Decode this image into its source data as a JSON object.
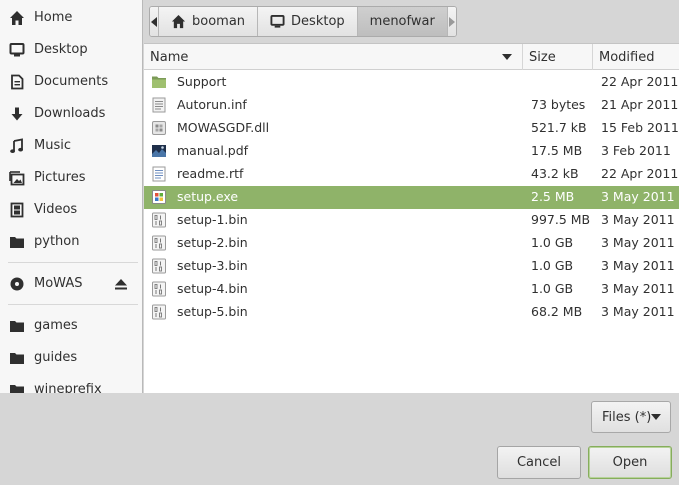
{
  "sidebar": {
    "items": [
      {
        "label": "Home",
        "icon": "home-icon"
      },
      {
        "label": "Desktop",
        "icon": "desktop-icon"
      },
      {
        "label": "Documents",
        "icon": "documents-icon"
      },
      {
        "label": "Downloads",
        "icon": "download-icon"
      },
      {
        "label": "Music",
        "icon": "music-icon"
      },
      {
        "label": "Pictures",
        "icon": "pictures-icon"
      },
      {
        "label": "Videos",
        "icon": "videos-icon"
      },
      {
        "label": "python",
        "icon": "folder-icon"
      }
    ],
    "device": {
      "label": "MoWAS",
      "icon": "disc-icon"
    },
    "bookmarks": [
      {
        "label": "games",
        "icon": "folder-icon"
      },
      {
        "label": "guides",
        "icon": "folder-icon"
      },
      {
        "label": "wineprefix",
        "icon": "folder-icon"
      }
    ]
  },
  "pathbar": {
    "crumbs": [
      "booman",
      "Desktop",
      "menofwar"
    ]
  },
  "list": {
    "columns": {
      "name": "Name",
      "size": "Size",
      "modified": "Modified"
    },
    "files": [
      {
        "name": "Support",
        "size": "",
        "modified": "22 Apr 2011",
        "icon": "folder-icon"
      },
      {
        "name": "Autorun.inf",
        "size": "73 bytes",
        "modified": "21 Apr 2011",
        "icon": "text-file-icon"
      },
      {
        "name": "MOWASGDF.dll",
        "size": "521.7 kB",
        "modified": "15 Feb 2011",
        "icon": "dll-file-icon"
      },
      {
        "name": "manual.pdf",
        "size": "17.5 MB",
        "modified": "3 Feb 2011",
        "icon": "pdf-file-icon"
      },
      {
        "name": "readme.rtf",
        "size": "43.2 kB",
        "modified": "22 Apr 2011",
        "icon": "rtf-file-icon"
      },
      {
        "name": "setup.exe",
        "size": "2.5 MB",
        "modified": "3 May 2011",
        "icon": "exe-file-icon",
        "selected": true
      },
      {
        "name": "setup-1.bin",
        "size": "997.5 MB",
        "modified": "3 May 2011",
        "icon": "binary-file-icon"
      },
      {
        "name": "setup-2.bin",
        "size": "1.0 GB",
        "modified": "3 May 2011",
        "icon": "binary-file-icon"
      },
      {
        "name": "setup-3.bin",
        "size": "1.0 GB",
        "modified": "3 May 2011",
        "icon": "binary-file-icon"
      },
      {
        "name": "setup-4.bin",
        "size": "1.0 GB",
        "modified": "3 May 2011",
        "icon": "binary-file-icon"
      },
      {
        "name": "setup-5.bin",
        "size": "68.2 MB",
        "modified": "3 May 2011",
        "icon": "binary-file-icon"
      }
    ]
  },
  "filter": {
    "label": "Files (*)"
  },
  "buttons": {
    "cancel": "Cancel",
    "open": "Open"
  },
  "colors": {
    "selection": "#8fb369",
    "accent": "#86ad5c"
  }
}
